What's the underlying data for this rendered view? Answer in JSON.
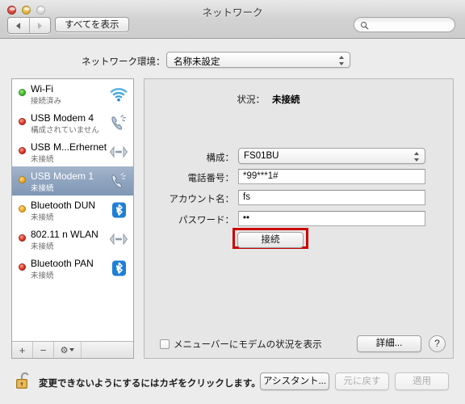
{
  "window": {
    "title": "ネットワーク",
    "traffic_lights": [
      "close",
      "minimize",
      "zoom"
    ]
  },
  "toolbar": {
    "back_icon": "triangle-left-icon",
    "forward_icon": "triangle-right-icon",
    "show_all_label": "すべてを表示",
    "search_placeholder": "",
    "search_value": "",
    "search_icon": "search-icon"
  },
  "location": {
    "label": "ネットワーク環境：",
    "value": "名称未設定"
  },
  "sidebar": {
    "services": [
      {
        "name": "Wi-Fi",
        "status": "接続済み",
        "dot": "green",
        "icon": "wifi-icon",
        "selected": false
      },
      {
        "name": "USB Modem 4",
        "status": "構成されていません",
        "dot": "red",
        "icon": "modem-icon",
        "selected": false
      },
      {
        "name": "USB M...Erhernet",
        "status": "未接続",
        "dot": "red",
        "icon": "ethernet-icon",
        "selected": false
      },
      {
        "name": "USB Modem 1",
        "status": "未接続",
        "dot": "orange",
        "icon": "modem-icon",
        "selected": true
      },
      {
        "name": "Bluetooth DUN",
        "status": "未接続",
        "dot": "orange",
        "icon": "bluetooth-icon",
        "selected": false
      },
      {
        "name": "802.11 n WLAN",
        "status": "未接続",
        "dot": "red",
        "icon": "ethernet-icon",
        "selected": false
      },
      {
        "name": "Bluetooth PAN",
        "status": "未接続",
        "dot": "red",
        "icon": "bluetooth-icon",
        "selected": false
      }
    ],
    "footer": {
      "add_label": "+",
      "remove_label": "−",
      "action_label": "⚙"
    }
  },
  "detail": {
    "status_label": "状況：",
    "status_value": "未接続",
    "config_label": "構成：",
    "config_value": "FS01BU",
    "phone_label": "電話番号：",
    "phone_value": "*99***1#",
    "account_label": "アカウント名：",
    "account_value": "fs",
    "password_label": "パスワード：",
    "password_value": "••",
    "connect_label": "接続",
    "show_modem_label": "メニューバーにモデムの状況を表示",
    "show_modem_checked": false,
    "advanced_label": "詳細...",
    "help_label": "?"
  },
  "bottom": {
    "lock_icon": "unlocked-padlock-icon",
    "lock_text": "変更できないようにするにはカギをクリックします。",
    "assistant_label": "アシスタント...",
    "revert_label": "元に戻す",
    "apply_label": "適用"
  },
  "annotation": {
    "highlight_color": "#cc0000",
    "target": "接続"
  }
}
